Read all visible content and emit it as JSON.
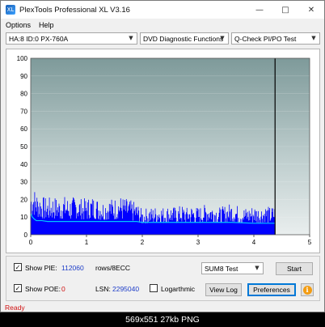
{
  "window": {
    "title": "PlexTools Professional XL V3.16",
    "icon": "plextools-icon",
    "controls": [
      "minimize-icon",
      "maximize-icon",
      "close-icon"
    ]
  },
  "menu": {
    "options": "Options",
    "help": "Help"
  },
  "toolbar": {
    "drive": "HA:8 ID:0  PX-760A",
    "function": "DVD Diagnostic Functions",
    "test": "Q-Check PI/PO Test"
  },
  "chart_data": {
    "type": "area",
    "title": "",
    "xlabel": "",
    "ylabel": "",
    "xlim": [
      0,
      5
    ],
    "ylim": [
      0,
      100
    ],
    "x_ticks": [
      "0",
      "1",
      "2",
      "3",
      "4",
      "5"
    ],
    "y_ticks": [
      "0",
      "10",
      "20",
      "30",
      "40",
      "50",
      "60",
      "70",
      "80",
      "90",
      "100"
    ],
    "end_marker_x": 4.38,
    "series": [
      {
        "color": "#0000ff",
        "x": [
          0,
          0.05,
          0.1,
          0.2,
          0.3,
          0.4,
          0.5,
          0.6,
          0.7,
          0.8,
          0.9,
          1.0,
          1.1,
          1.2,
          1.3,
          1.4,
          1.5,
          1.6,
          1.7,
          1.8,
          1.9,
          2.0,
          2.1,
          2.2,
          2.3,
          2.4,
          2.5,
          2.6,
          2.7,
          2.8,
          2.9,
          3.0,
          3.1,
          3.2,
          3.3,
          3.4,
          3.5,
          3.6,
          3.7,
          3.8,
          3.9,
          4.0,
          4.1,
          4.2,
          4.3,
          4.38
        ],
        "values": [
          20,
          21,
          19,
          17,
          16,
          17,
          16,
          17,
          16,
          17,
          16,
          16,
          17,
          16,
          15,
          16,
          16,
          17,
          16,
          15,
          14,
          11,
          12,
          12,
          13,
          12,
          13,
          12,
          13,
          12,
          13,
          12,
          13,
          14,
          13,
          12,
          13,
          14,
          13,
          12,
          12,
          13,
          12,
          13,
          12,
          13
        ]
      },
      {
        "color": "#00c8ff",
        "x": [
          0,
          0.03,
          0.06,
          0.1,
          0.15,
          0.2,
          0.3,
          0.5,
          0.8,
          1.0,
          1.3,
          1.6,
          1.9,
          2.0,
          2.3,
          2.6,
          3.0,
          3.3,
          3.6,
          4.0,
          4.2,
          4.38
        ],
        "values": [
          12,
          10,
          9,
          8,
          8,
          8,
          7.5,
          7.5,
          7.5,
          7.5,
          7.5,
          7.5,
          7.5,
          7,
          7,
          7,
          7,
          7,
          7,
          6.5,
          6.5,
          6.5
        ]
      }
    ]
  },
  "controls": {
    "show_pie_label": "Show PIE:",
    "pie_value": "112060",
    "pie_unit": "rows/8ECC",
    "show_poe_label": "Show POE:",
    "poe_value": "0",
    "lsn_label": "LSN:",
    "lsn_value": "2295040",
    "logarithmic_label": "Logarthmic",
    "sum_test": "SUM8 Test",
    "start": "Start",
    "view_log": "View Log",
    "preferences": "Preferences"
  },
  "status": "Ready",
  "caption": "569x551  27kb  PNG"
}
